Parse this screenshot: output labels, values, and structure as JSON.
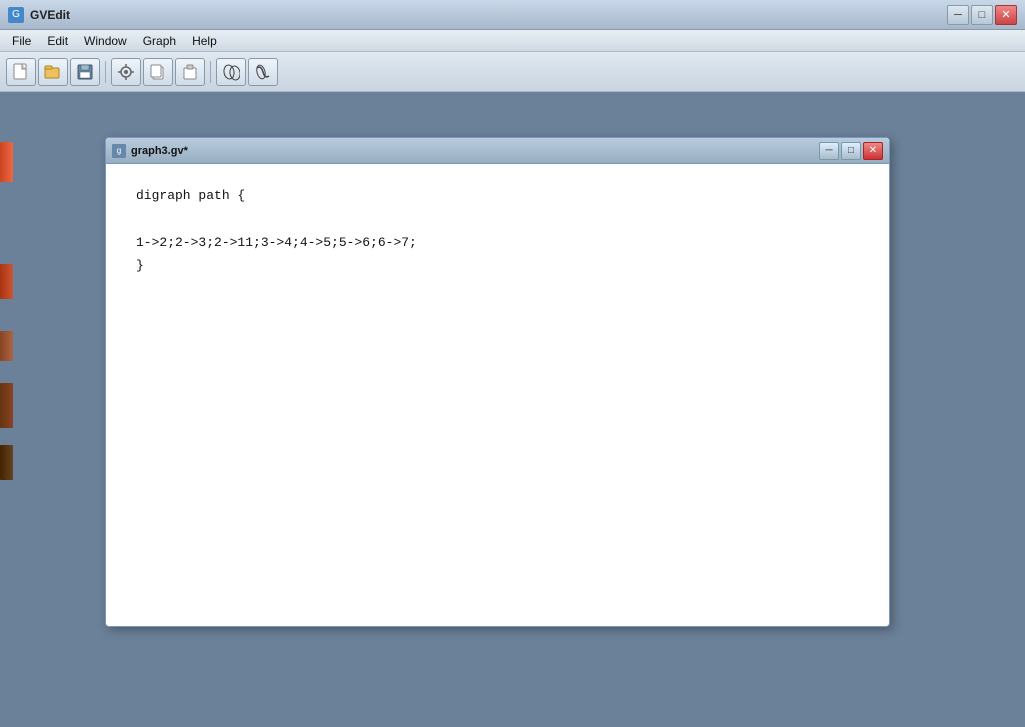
{
  "app": {
    "title": "GVEdit",
    "icon_label": "G"
  },
  "menubar": {
    "items": [
      "File",
      "Edit",
      "Window",
      "Graph",
      "Help"
    ]
  },
  "toolbar": {
    "buttons": [
      {
        "name": "new-button",
        "icon": "📄"
      },
      {
        "name": "open-button",
        "icon": "📂"
      },
      {
        "name": "save-button",
        "icon": "💾"
      },
      {
        "name": "preferences-button",
        "icon": "⚙"
      },
      {
        "name": "copy-button",
        "icon": "📋"
      },
      {
        "name": "paste-button",
        "icon": "📌"
      },
      {
        "name": "run-button",
        "icon": "▶"
      },
      {
        "name": "run-fast-button",
        "icon": "⚡"
      }
    ]
  },
  "document": {
    "title": "graph3.gv*",
    "icon_label": "g",
    "content_line1": "digraph  path {",
    "content_line2": "    1->2;2->3;2->11;3->4;4->5;5->6;6->7;",
    "content_line3": "}"
  },
  "window_controls": {
    "minimize": "─",
    "maximize": "□",
    "close": "✕"
  },
  "doc_controls": {
    "minimize": "─",
    "maximize": "□",
    "close": "✕"
  }
}
